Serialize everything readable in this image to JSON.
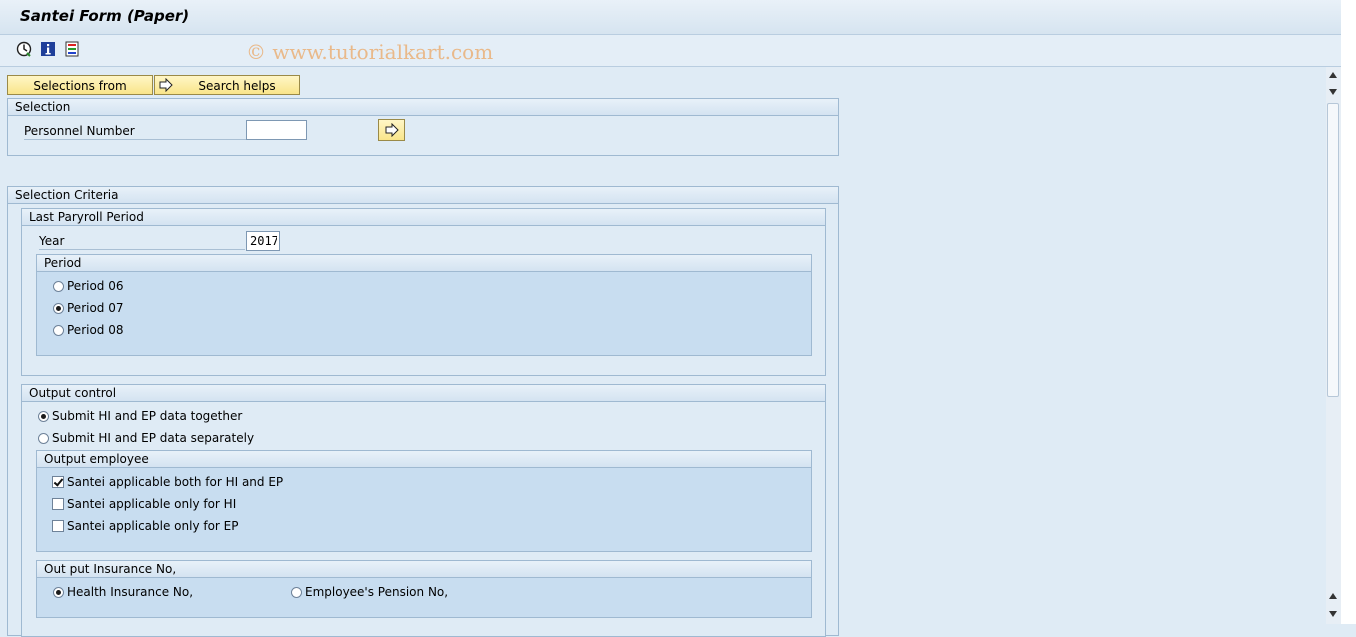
{
  "window": {
    "title": "Santei Form (Paper)"
  },
  "toolbar": {
    "icons": [
      "execute-icon",
      "info-icon",
      "variants-icon"
    ],
    "watermark": "© www.tutorialkart.com"
  },
  "buttons": {
    "selections_from": "Selections from",
    "search_helps": "Search helps"
  },
  "selection": {
    "title": "Selection",
    "personnel_label": "Personnel Number",
    "personnel_value": ""
  },
  "criteria": {
    "title": "Selection Criteria",
    "payroll": {
      "title": "Last Paryroll Period",
      "year_label": "Year",
      "year_value": "2017",
      "period": {
        "title": "Period",
        "options": [
          {
            "label": "Period 06",
            "selected": false
          },
          {
            "label": "Period 07",
            "selected": true
          },
          {
            "label": "Period 08",
            "selected": false
          }
        ]
      }
    },
    "output": {
      "title": "Output control",
      "options": [
        {
          "label": "Submit HI and EP data together",
          "selected": true
        },
        {
          "label": "Submit HI and EP data separately",
          "selected": false
        }
      ],
      "employee": {
        "title": "Output employee",
        "checks": [
          {
            "label": "Santei applicable both for HI and EP",
            "checked": true
          },
          {
            "label": "Santei applicable only for HI",
            "checked": false
          },
          {
            "label": "Santei applicable only for EP",
            "checked": false
          }
        ]
      },
      "insurance": {
        "title": "Out put Insurance No,",
        "options": [
          {
            "label": "Health Insurance No,",
            "selected": true
          },
          {
            "label": "Employee's Pension No,",
            "selected": false
          }
        ]
      }
    }
  }
}
